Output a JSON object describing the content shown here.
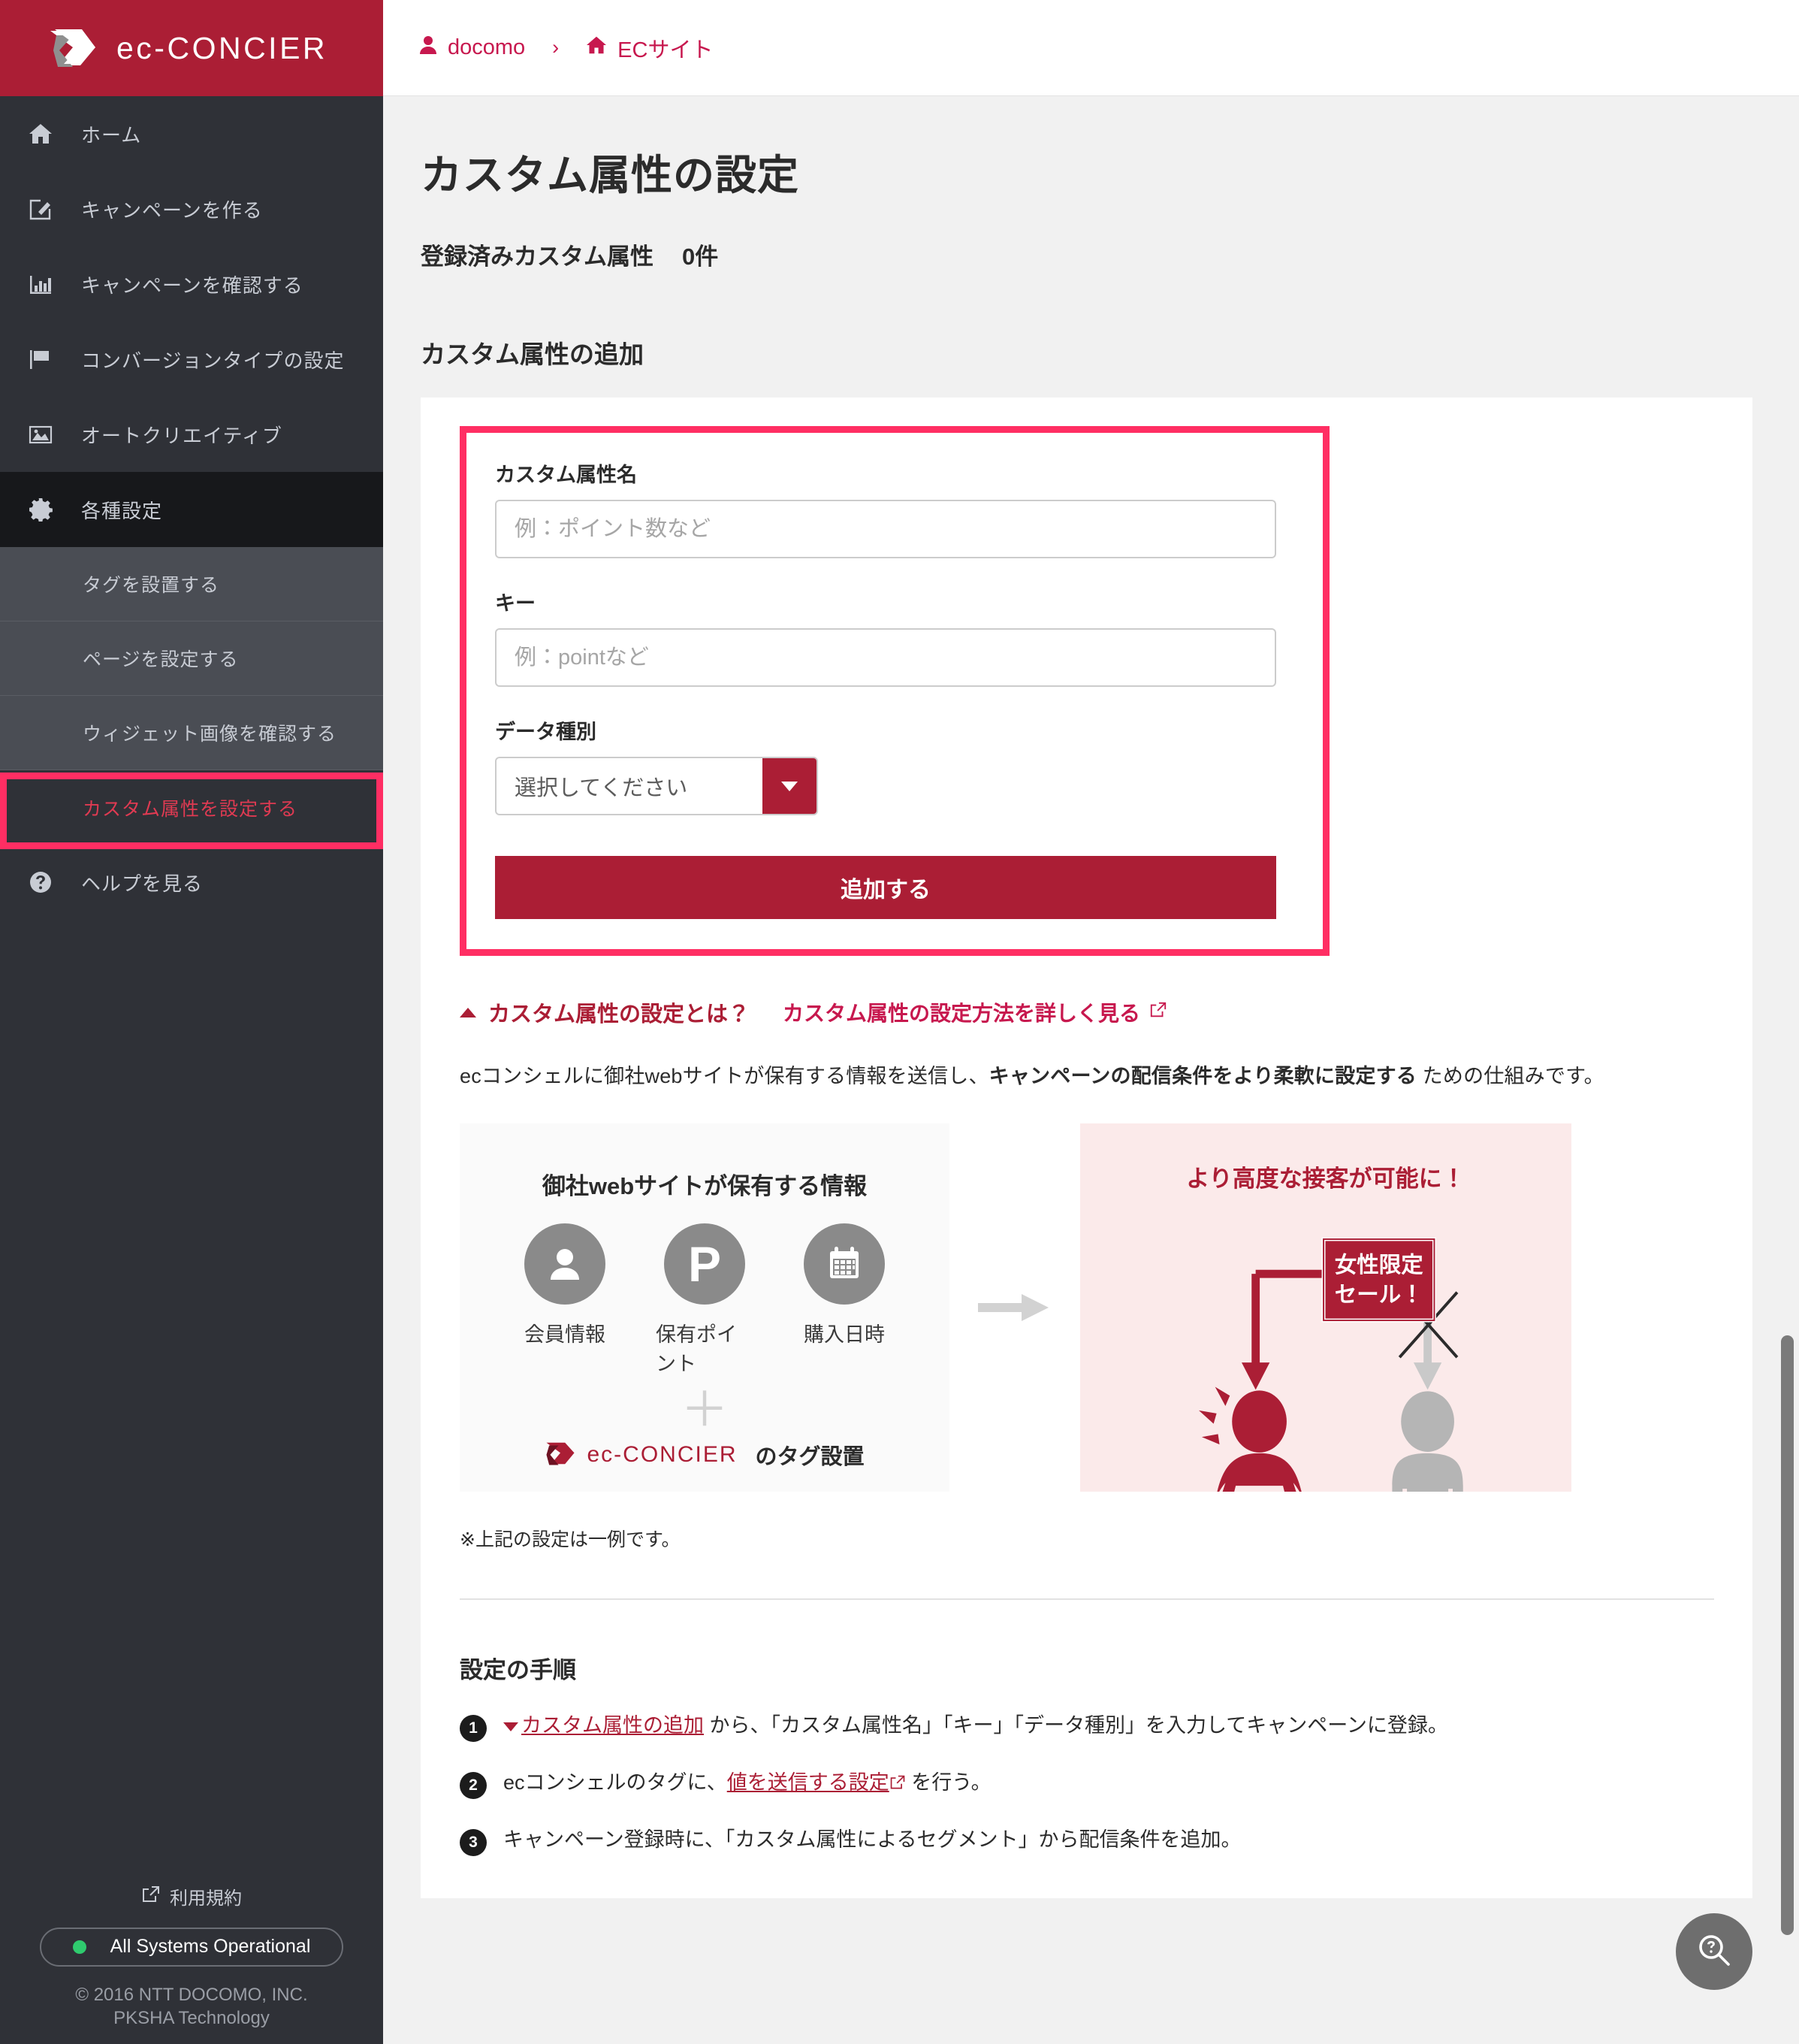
{
  "brand": {
    "name": "ec-CONCIER",
    "mark": "ec-concier-logo"
  },
  "sidebar": {
    "nav": [
      {
        "label": "ホーム",
        "icon": "home-icon"
      },
      {
        "label": "キャンペーンを作る",
        "icon": "edit-square-icon"
      },
      {
        "label": "キャンペーンを確認する",
        "icon": "bar-chart-icon"
      },
      {
        "label": "コンバージョンタイプの設定",
        "icon": "flag-icon"
      },
      {
        "label": "オートクリエイティブ",
        "icon": "image-icon"
      },
      {
        "label": "各種設定",
        "icon": "gear-icon"
      }
    ],
    "subnav": [
      {
        "label": "タグを設置する"
      },
      {
        "label": "ページを設定する"
      },
      {
        "label": "ウィジェット画像を確認する"
      },
      {
        "label": "カスタム属性を設定する"
      }
    ],
    "help": {
      "label": "ヘルプを見る",
      "icon": "question-circle-icon"
    },
    "footer": {
      "terms_label": "利用規約",
      "terms_icon": "external-link-icon",
      "status_label": "All Systems Operational",
      "status_color": "#2fcb6e",
      "copyright_line1": "© 2016 NTT DOCOMO, INC.",
      "copyright_line2": "PKSHA Technology"
    }
  },
  "breadcrumb": {
    "account": "docomo",
    "account_icon": "user-icon",
    "separator": "›",
    "site": "ECサイト",
    "site_icon": "home-icon"
  },
  "page": {
    "title": "カスタム属性の設定",
    "registered_label": "登録済みカスタム属性",
    "registered_count": "0件",
    "add_section_title": "カスタム属性の追加"
  },
  "form": {
    "name_label": "カスタム属性名",
    "name_placeholder": "例：ポイント数など",
    "name_value": "",
    "key_label": "キー",
    "key_placeholder": "例：pointなど",
    "key_value": "",
    "type_label": "データ種別",
    "type_selected": "選択してください",
    "submit_label": "追加する",
    "highlight_color": "#ff2e63",
    "accent_color": "#ab1e35"
  },
  "explain": {
    "toggle_label": "カスタム属性の設定とは？",
    "link_label": "カスタム属性の設定方法を詳しく見る",
    "link_icon": "external-link-icon",
    "body_pre": "ecコンシェルに御社webサイトが保有する情報を送信し、",
    "body_strong": "キャンペーンの配信条件をより柔軟に設定する",
    "body_post": " ための仕組みです。",
    "note": "※上記の設定は一例です。"
  },
  "diagram": {
    "left_title": "御社webサイトが保有する情報",
    "items": [
      {
        "caption": "会員情報",
        "icon": "person-icon"
      },
      {
        "caption": "保有ポイント",
        "icon": "point-p-icon"
      },
      {
        "caption": "購入日時",
        "icon": "calendar-icon"
      }
    ],
    "plus": "＋",
    "tag_brand": "ec-CONCIER",
    "tag_suffix": "のタグ設置",
    "arrow_icon": "right-arrow-icon",
    "right_title": "より高度な接客が可能に！",
    "badge_line1": "女性限定",
    "badge_line2": "セール！",
    "female_icon": "female-figure-icon",
    "male_icon": "male-figure-icon",
    "cross_icon": "cross-mark-icon"
  },
  "steps": {
    "title": "設定の手順",
    "items": [
      {
        "num": "❶",
        "link": "カスタム属性の追加",
        "text": " から、「カスタム属性名」「キー」「データ種別」を入力してキャンペーンに登録。",
        "has_caret": true
      },
      {
        "num": "❷",
        "pre": "ecコンシェルのタグに、",
        "link": "値を送信する設定",
        "text": " を行う。",
        "has_ext_icon": true
      },
      {
        "num": "❸",
        "text": "キャンペーン登録時に、「カスタム属性によるセグメント」から配信条件を追加。"
      }
    ]
  },
  "fab": {
    "icon": "help-search-icon"
  },
  "scrollbar": {
    "name": "vertical-scrollbar"
  }
}
